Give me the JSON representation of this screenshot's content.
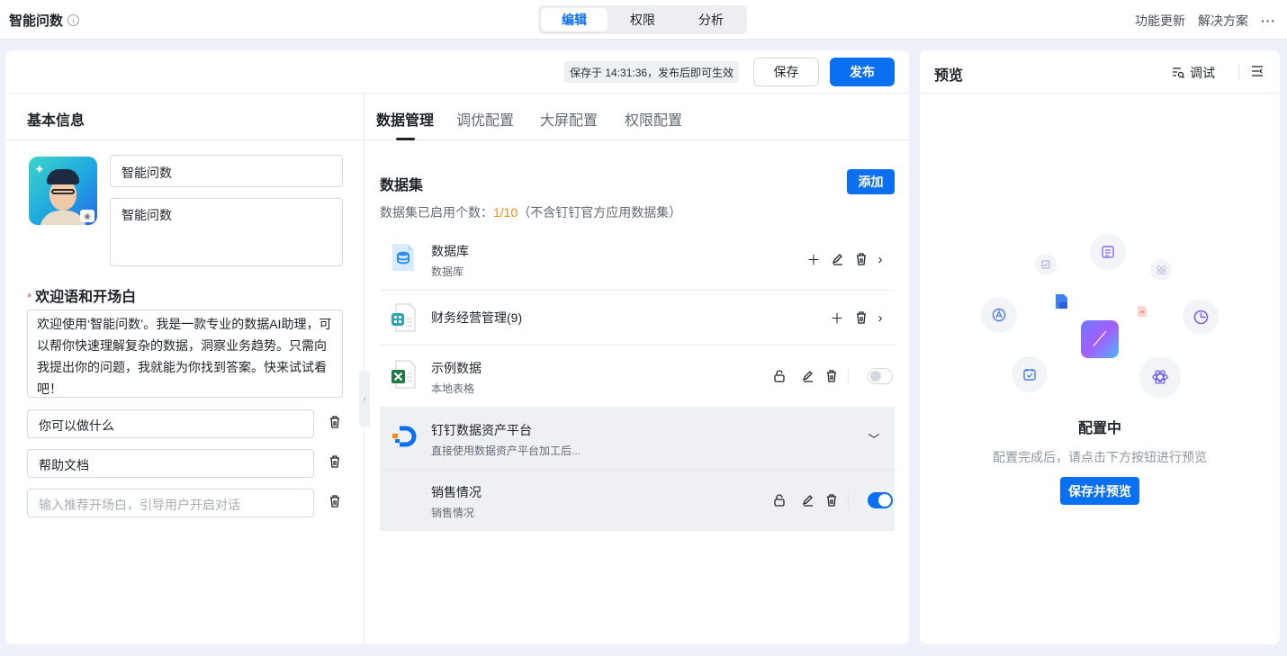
{
  "app": {
    "title": "智能问数"
  },
  "top_tabs": [
    {
      "label": "编辑"
    },
    {
      "label": "权限"
    },
    {
      "label": "分析"
    }
  ],
  "top_right": {
    "feature_update": "功能更新",
    "solution": "解决方案",
    "more": "···"
  },
  "header": {
    "save_status": "保存于 14:31:36，发布后即可生效",
    "save_label": "保存",
    "publish_label": "发布"
  },
  "basic": {
    "title": "基本信息",
    "name_value": "智能问数",
    "desc_value": "智能问数",
    "welcome_label": "欢迎语和开场白",
    "welcome_text": "欢迎使用‘智能问数’。我是一款专业的数据AI助理，可以帮你快速理解复杂的数据，洞察业务趋势。只需向我提出你的问题，我就能为你找到答案。快来试试看吧！",
    "openers": [
      "你可以做什么",
      "帮助文档"
    ],
    "opener_placeholder": "输入推荐开场白，引导用户开启对话"
  },
  "config_tabs": [
    {
      "label": "数据管理"
    },
    {
      "label": "调优配置"
    },
    {
      "label": "大屏配置"
    },
    {
      "label": "权限配置"
    }
  ],
  "dataset": {
    "title": "数据集",
    "add_label": "添加",
    "count_prefix": "数据集已启用个数：",
    "count_value": "1/10",
    "count_suffix": "（不含钉钉官方应用数据集）",
    "items": [
      {
        "name": "数据库",
        "sub": "数据库"
      },
      {
        "name": "财务经营管理(9)"
      },
      {
        "name": "示例数据",
        "sub": "本地表格",
        "enabled": false
      },
      {
        "name": "钉钉数据资产平台",
        "sub": "直接使用数据资产平台加工后..."
      },
      {
        "name": "销售情况",
        "sub": "销售情况",
        "enabled": true
      }
    ]
  },
  "preview": {
    "title": "预览",
    "debug_label": "调试",
    "status": "配置中",
    "hint": "配置完成后，请点击下方按钮进行预览",
    "button_label": "保存并预览"
  },
  "colors": {
    "primary": "#0b6ff2",
    "highlight": "#f58a0b",
    "danger": "#f54a45"
  }
}
